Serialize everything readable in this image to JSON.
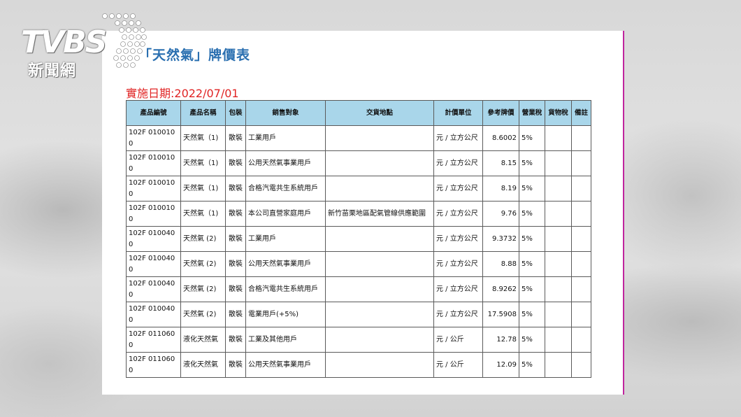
{
  "logo": {
    "brand": "TVBS",
    "sub": "新聞網"
  },
  "title": "「天然氣」牌價表",
  "effective_date": "實施日期:2022/07/01",
  "table": {
    "headers": [
      "產品編號",
      "產品名稱",
      "包裝",
      "銷售對象",
      "交貨地點",
      "計價單位",
      "參考牌價",
      "營業稅",
      "貨物稅",
      "備註"
    ],
    "rows": [
      [
        "102F 0100100",
        "天然氣（1)",
        "散裝",
        "工業用戶",
        "",
        "元 / 立方公尺",
        "8.6002",
        "5%",
        "",
        ""
      ],
      [
        "102F 0100100",
        "天然氣（1)",
        "散裝",
        "公用天然氣事業用戶",
        "",
        "元 / 立方公尺",
        "8.15",
        "5%",
        "",
        ""
      ],
      [
        "102F 0100100",
        "天然氣（1)",
        "散裝",
        "合格汽電共生系統用戶",
        "",
        "元 / 立方公尺",
        "8.19",
        "5%",
        "",
        ""
      ],
      [
        "102F 0100100",
        "天然氣（1)",
        "散裝",
        "本公司直營家庭用戶",
        "新竹苗栗地區配氣管線供應範圍",
        "元 / 立方公尺",
        "9.76",
        "5%",
        "",
        ""
      ],
      [
        "102F 0100400",
        "天然氣 (2)",
        "散裝",
        "工業用戶",
        "",
        "元 / 立方公尺",
        "9.3732",
        "5%",
        "",
        ""
      ],
      [
        "102F 0100400",
        "天然氣 (2)",
        "散裝",
        "公用天然氣事業用戶",
        "",
        "元 / 立方公尺",
        "8.88",
        "5%",
        "",
        ""
      ],
      [
        "102F 0100400",
        "天然氣 (2)",
        "散裝",
        "合格汽電共生系統用戶",
        "",
        "元 / 立方公尺",
        "8.9262",
        "5%",
        "",
        ""
      ],
      [
        "102F 0100400",
        "天然氣 (2)",
        "散裝",
        "電業用戶(+5%)",
        "",
        "元 / 立方公尺",
        "17.5908",
        "5%",
        "",
        ""
      ],
      [
        "102F 0110600",
        "液化天然氣",
        "散裝",
        "工業及其他用戶",
        "",
        "元 / 公斤",
        "12.78",
        "5%",
        "",
        ""
      ],
      [
        "102F 0110600",
        "液化天然氣",
        "散裝",
        "公用天然氣事業用戶",
        "",
        "元 / 公斤",
        "12.09",
        "5%",
        "",
        ""
      ]
    ]
  }
}
